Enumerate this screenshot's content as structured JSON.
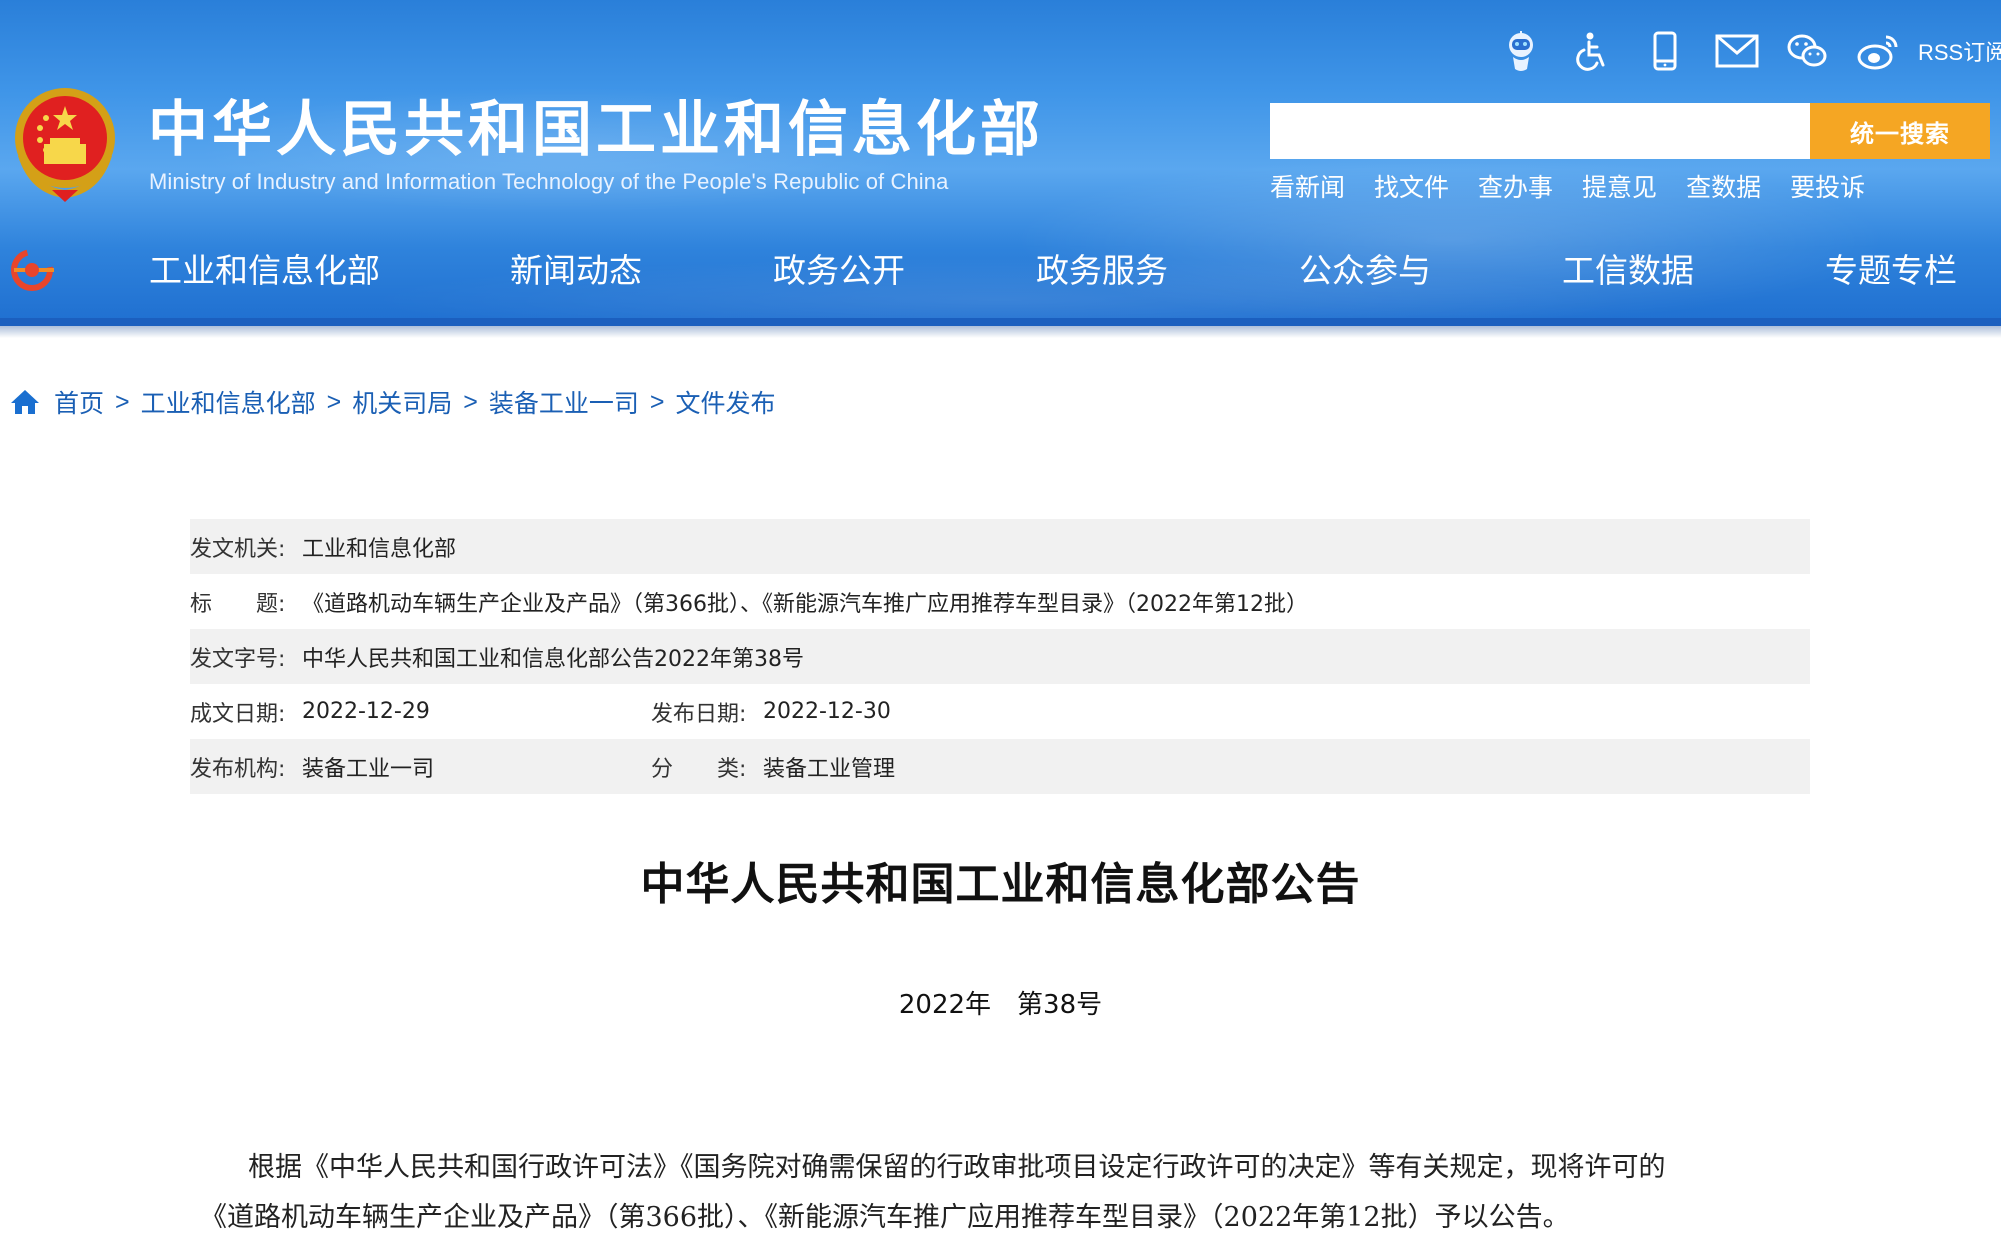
{
  "site": {
    "title": "中华人民共和国工业和信息化部",
    "subtitle": "Ministry of Industry and Information Technology of the People's Republic of China"
  },
  "top_icons": {
    "rss_label": "RSS订阅"
  },
  "search": {
    "button_label": "统一搜索",
    "placeholder": ""
  },
  "quick_links": [
    "看新闻",
    "找文件",
    "查办事",
    "提意见",
    "查数据",
    "要投诉"
  ],
  "nav": [
    "工业和信息化部",
    "新闻动态",
    "政务公开",
    "政务服务",
    "公众参与",
    "工信数据",
    "专题专栏"
  ],
  "breadcrumb": [
    "首页",
    "工业和信息化部",
    "机关司局",
    "装备工业一司",
    "文件发布"
  ],
  "breadcrumb_sep": ">",
  "meta": {
    "issuer_label": "发文机关:",
    "issuer_value": "工业和信息化部",
    "title_label": "标　　题:",
    "title_value": "《道路机动车辆生产企业及产品》（第366批）、《新能源汽车推广应用推荐车型目录》（2022年第12批）",
    "docno_label": "发文字号:",
    "docno_value": "中华人民共和国工业和信息化部公告2022年第38号",
    "written_label": "成文日期:",
    "written_value": "2022-12-29",
    "published_label": "发布日期:",
    "published_value": "2022-12-30",
    "org_label": "发布机构:",
    "org_value": "装备工业一司",
    "category_label": "分　　类:",
    "category_value": "装备工业管理"
  },
  "document": {
    "title": "中华人民共和国工业和信息化部公告",
    "number": "2022年　第38号",
    "body_line1": "根据《中华人民共和国行政许可法》《国务院对确需保留的行政审批项目设定行政许可的决定》等有关规定，现将许可的",
    "body_line2": "《道路机动车辆生产企业及产品》（第366批）、《新能源汽车推广应用推荐车型目录》（2022年第12批）予以公告。"
  },
  "colors": {
    "header_blue": "#2f83dc",
    "search_button": "#f5a623",
    "link_blue": "#1a5fb4",
    "meta_shade": "#f1f1f1"
  }
}
